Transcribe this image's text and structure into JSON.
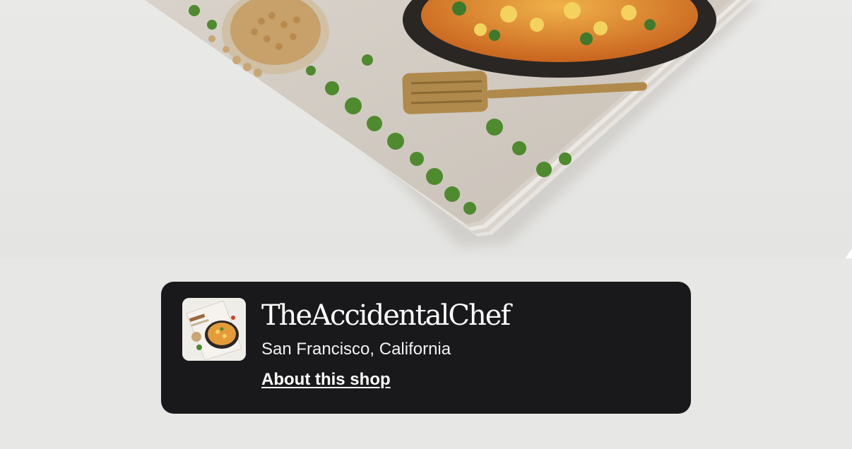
{
  "hero": {
    "image_icon": "cookbook-product-photo"
  },
  "shop": {
    "name": "TheAccidentalChef",
    "location": "San Francisco, California",
    "about_link": "About this shop",
    "thumbnail_icon": "shop-logo-cookbook-cover"
  }
}
